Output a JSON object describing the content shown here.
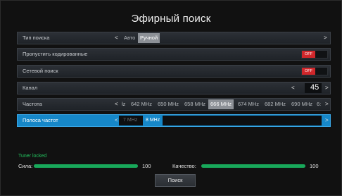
{
  "title": "Эфирный поиск",
  "rows": {
    "search_type": {
      "label": "Тип поиска",
      "options": [
        "Авто",
        "Ручной"
      ],
      "selected": "Ручной",
      "arrow_left": "<",
      "arrow_right": ">"
    },
    "skip_scrambled": {
      "label": "Пропустить кодированные",
      "value": "OFF"
    },
    "network_search": {
      "label": "Сетевой поиск",
      "value": "OFF"
    },
    "channel": {
      "label": "Канал",
      "value": "45",
      "arrow_left": "<",
      "arrow_right": ">"
    },
    "frequency": {
      "label": "Частота",
      "arrow_left": "<",
      "arrow_right": ">",
      "options": [
        "łz",
        "642 MHz",
        "650 MHz",
        "658 MHz",
        "666 MHz",
        "674 MHz",
        "682 MHz",
        "690 MHz",
        "6:"
      ],
      "selected": "666 MHz"
    },
    "bandwidth": {
      "label": "Полоса частот",
      "options": [
        "7 MHz",
        "8 MHz"
      ],
      "selected": "8 MHz",
      "arrow_left": "<",
      "arrow_right": ">"
    }
  },
  "status": "Tuner locked",
  "strength": {
    "label": "Сила:",
    "value": "100",
    "level": 1.0
  },
  "quality": {
    "label": "Качество:",
    "value": "100",
    "level": 1.0
  },
  "search_button": "Поиск",
  "colors": {
    "accent": "#1687c8",
    "off": "#d0262a",
    "meter": "#18a85a",
    "status": "#23c25e"
  }
}
